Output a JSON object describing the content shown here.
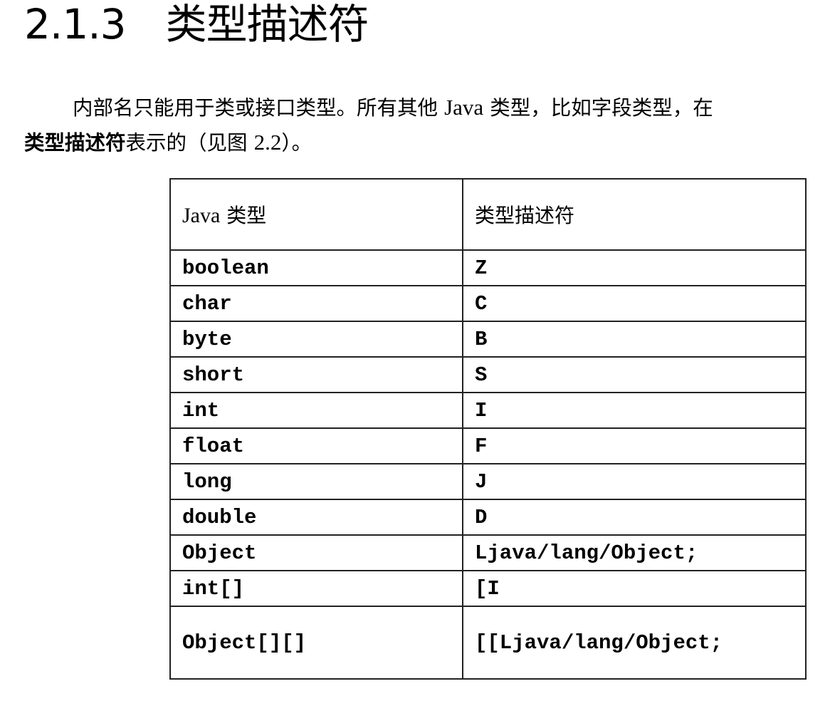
{
  "section": {
    "number": "2.1.3",
    "title": "类型描述符"
  },
  "paragraph": {
    "line1_pre": "内部名只能用于类或接口类型。所有其他 ",
    "line1_java": "Java",
    "line1_post": " 类型，比如字段类型，在",
    "line2_bold": "类型描述符",
    "line2_pre": "表示的（见图 ",
    "line2_ref": "2.2",
    "line2_post": "）。"
  },
  "table": {
    "header": {
      "col1_latin": "Java",
      "col1_cjk": " 类型",
      "col2": "类型描述符"
    },
    "rows": [
      {
        "java_type": "boolean",
        "descriptor": "Z"
      },
      {
        "java_type": "char",
        "descriptor": "C"
      },
      {
        "java_type": "byte",
        "descriptor": "B"
      },
      {
        "java_type": "short",
        "descriptor": "S"
      },
      {
        "java_type": "int",
        "descriptor": "I"
      },
      {
        "java_type": "float",
        "descriptor": "F"
      },
      {
        "java_type": "long",
        "descriptor": "J"
      },
      {
        "java_type": "double",
        "descriptor": "D"
      },
      {
        "java_type": "Object",
        "descriptor": "Ljava/lang/Object;"
      },
      {
        "java_type": "int[]",
        "descriptor": "[I"
      },
      {
        "java_type": "Object[][]",
        "descriptor": "[[Ljava/lang/Object;"
      }
    ]
  }
}
